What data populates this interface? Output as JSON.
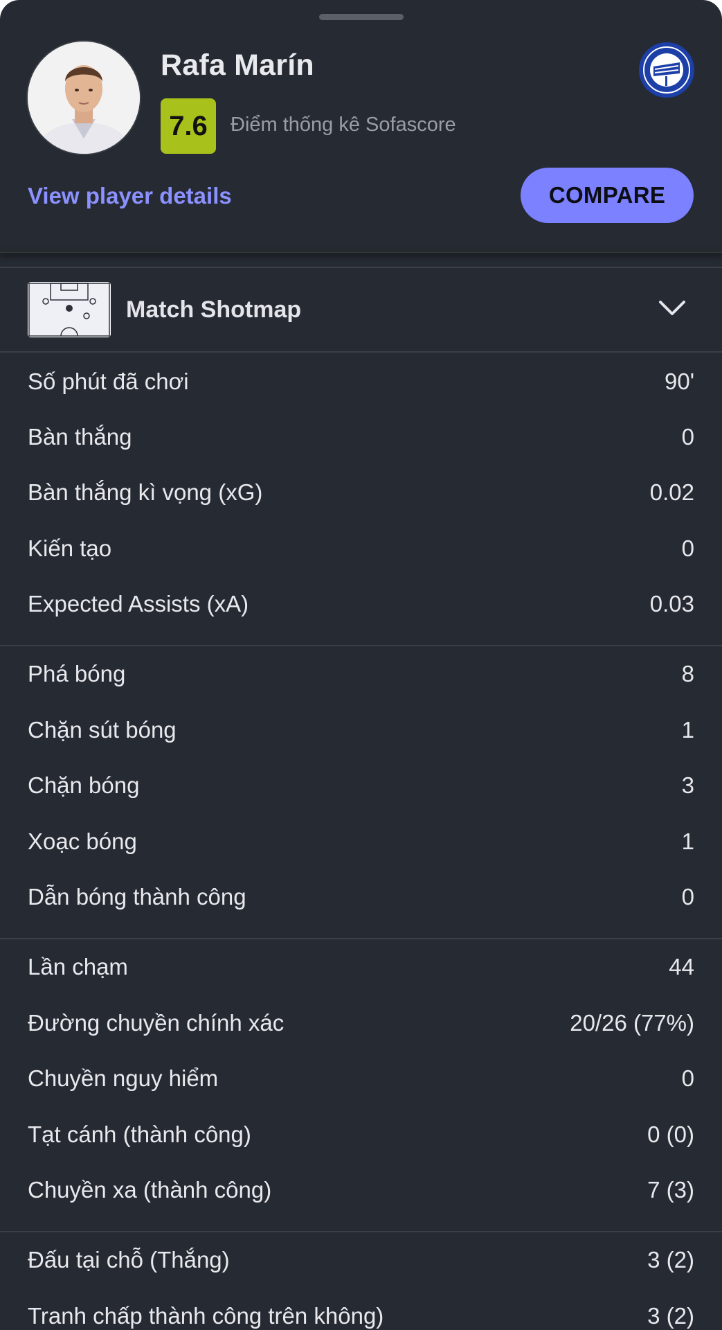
{
  "player": {
    "name": "Rafa Marín",
    "rating": "7.6",
    "rating_label": "Điểm thống kê Sofascore",
    "details_link": "View player details",
    "compare_button": "COMPARE",
    "rating_color": "#a8c21b",
    "accent_color": "#7b81ff"
  },
  "shotmap": {
    "title": "Match Shotmap",
    "icon": "pitch-icon",
    "toggle_icon": "chevron-down-icon"
  },
  "stat_groups": [
    [
      {
        "label": "Số phút đã chơi",
        "value": "90'"
      },
      {
        "label": "Bàn thắng",
        "value": "0"
      },
      {
        "label": "Bàn thắng kì vọng (xG)",
        "value": "0.02"
      },
      {
        "label": "Kiến tạo",
        "value": "0"
      },
      {
        "label": "Expected Assists (xA)",
        "value": "0.03"
      }
    ],
    [
      {
        "label": "Phá bóng",
        "value": "8"
      },
      {
        "label": "Chặn sút bóng",
        "value": "1"
      },
      {
        "label": "Chặn bóng",
        "value": "3"
      },
      {
        "label": "Xoạc bóng",
        "value": "1"
      },
      {
        "label": "Dẫn bóng thành công",
        "value": "0"
      }
    ],
    [
      {
        "label": "Lần chạm",
        "value": "44"
      },
      {
        "label": "Đường chuyền chính xác",
        "value": "20/26 (77%)"
      },
      {
        "label": "Chuyền nguy hiểm",
        "value": "0"
      },
      {
        "label": "Tạt cánh (thành công)",
        "value": "0 (0)"
      },
      {
        "label": "Chuyền xa (thành công)",
        "value": "7 (3)"
      }
    ],
    [
      {
        "label": "Đấu tại chỗ (Thắng)",
        "value": "3 (2)"
      },
      {
        "label": "Tranh chấp thành công trên không)",
        "value": "3 (2)"
      }
    ]
  ]
}
